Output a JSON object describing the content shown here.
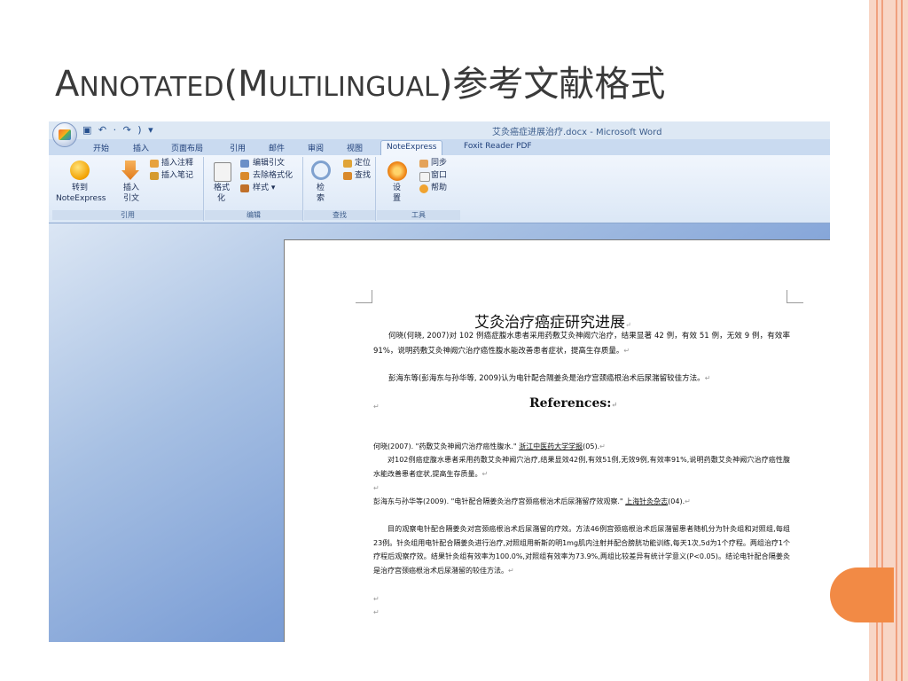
{
  "slide": {
    "title_prefix_A": "A",
    "title_small_1": "NNOTATED",
    "title_paren": "(",
    "title_M": "M",
    "title_small_2": "ULTILINGUAL",
    "title_suffix": ")参考文献格式"
  },
  "colors": {
    "accent": "#f28a45",
    "stripe": "#f8d6c6",
    "ribbon_blue": "#c9daf0"
  },
  "word": {
    "window_title": "艾灸癌症进展治疗.docx - Microsoft Word",
    "qat": "▣ ↶ · ↷ ) ▾",
    "tabs": [
      "开始",
      "插入",
      "页面布局",
      "引用",
      "邮件",
      "审阅",
      "视图",
      "NoteExpress",
      "Foxit Reader PDF"
    ],
    "active_tab": "NoteExpress",
    "ribbon": {
      "goto_label_1": "转到",
      "goto_label_2": "NoteExpress",
      "insert_label_1": "插入",
      "insert_label_2": "引文",
      "insert_note": "插入注释",
      "insert_memo": "插入笔记",
      "group_cite": "引用",
      "format_1": "格式",
      "format_2": "化",
      "edit_cite": "编辑引文",
      "remove_format": "去除格式化",
      "style": "样式 ▾",
      "group_edit": "编辑",
      "search_1": "检",
      "search_2": "索",
      "locate": "定位",
      "find": "查找",
      "group_find": "查找",
      "settings_1": "设",
      "settings_2": "置",
      "sync": "同步",
      "window": "窗口",
      "help": "帮助",
      "group_tools": "工具"
    }
  },
  "document": {
    "title": "艾灸治疗癌症研究进展",
    "para1_cite": "何晓(何晓, 2007)",
    "para1_text": "对 102 例癌症腹水患者采用药敷艾灸神阙穴治疗，结果显著 42 例，有效 51 例，无效 9 例，有效率 91%，说明药敷艾灸神阙穴治疗癌性腹水能改善患者症状，提高生存质量。",
    "para2_cite": "彭海东等(彭海东与孙华等, 2009)",
    "para2_text": "认为电针配合隔姜灸是治疗宫颈癌根治术后尿潴留较佳方法。",
    "references_heading": "References:",
    "ref1_head": "何晓(2007). \"药敷艾灸神阙穴治疗癌性腹水.\" ",
    "ref1_journal": "浙江中医药大学学报",
    "ref1_tail": "(05).",
    "ref1_abstract": "对102例癌症腹水患者采用药敷艾灸神阙穴治疗,结果显效42例,有效51例,无效9例,有效率91%,说明药敷艾灸神阙穴治疗癌性腹水能改善患者症状,提高生存质量。",
    "ref2_head": "彭海东与孙华等(2009). \"电针配合隔姜灸治疗宫颈癌根治术后尿潴留疗效观察.\" ",
    "ref2_journal": "上海针灸杂志",
    "ref2_tail": "(04).",
    "ref2_abstract": "目的观察电针配合隔姜灸对宫颈癌根治术后尿潴留的疗效。方法46例宫颈癌根治术后尿潴留患者随机分为针灸组和对照组,每组23例。针灸组用电针配合隔姜灸进行治疗,对照组用新斯的明1mg肌内注射并配合膀胱功能训练,每天1次,5d为1个疗程。两组治疗1个疗程后观察疗效。结果针灸组有效率为100.0%,对照组有效率为73.9%,两组比较差异有统计学意义(P<0.05)。结论电针配合隔姜灸是治疗宫颈癌根治术后尿潴留的较佳方法。",
    "para_mark": "↵"
  }
}
